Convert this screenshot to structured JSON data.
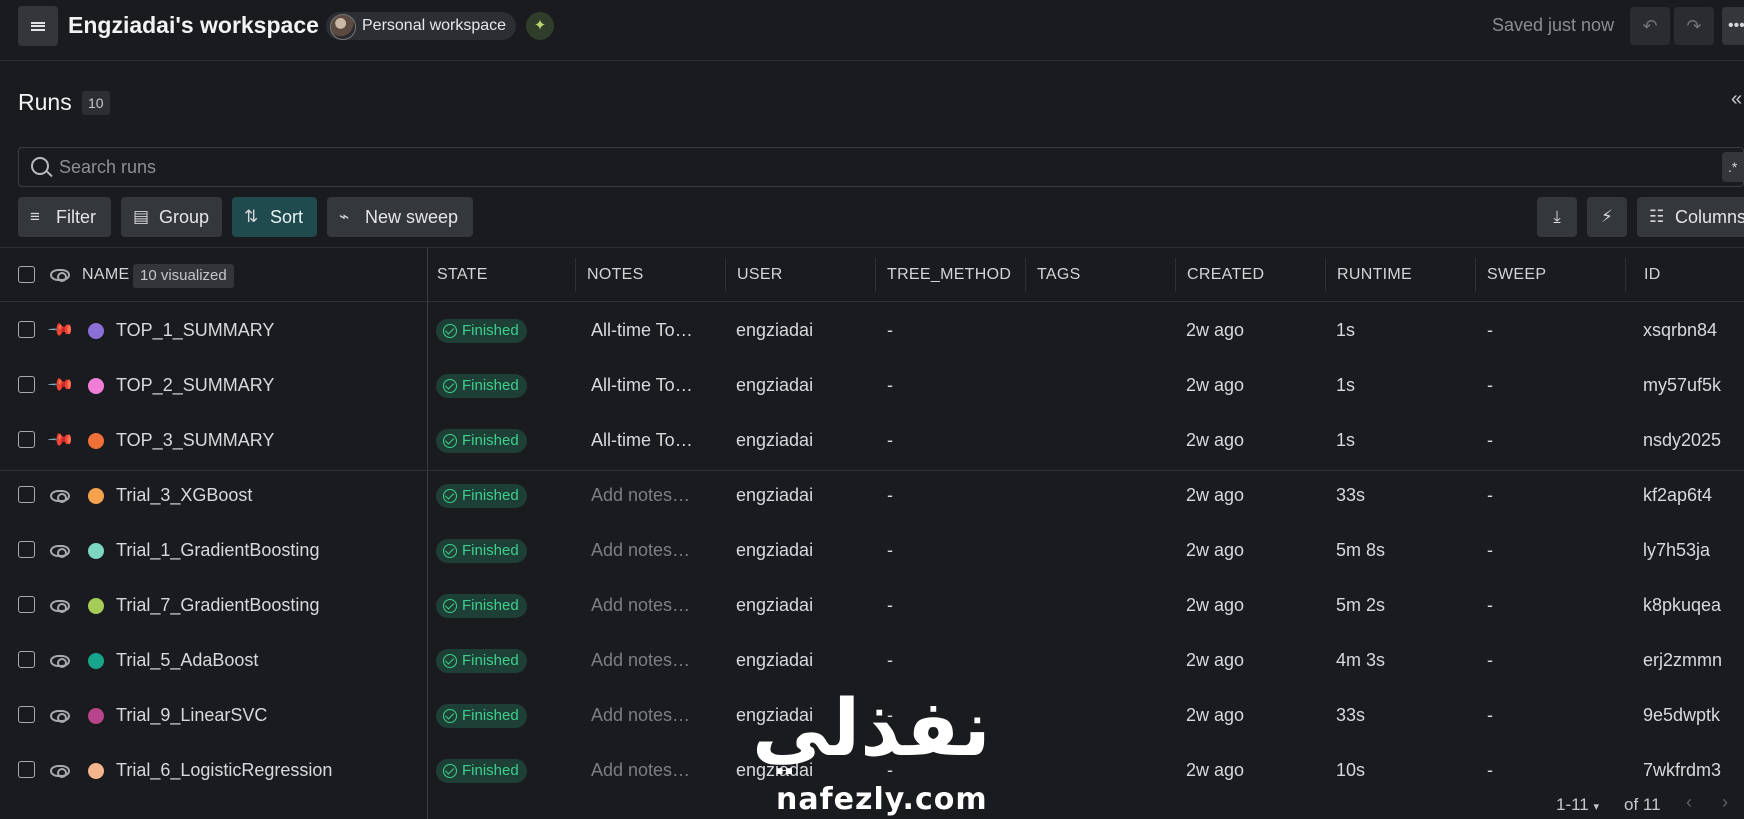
{
  "header": {
    "workspace_title": "Engziadai's workspace",
    "workspace_pill": "Personal workspace",
    "saved_status": "Saved just now"
  },
  "runs": {
    "title": "Runs",
    "count": "10",
    "search_placeholder": "Search runs",
    "regex_label": ".*"
  },
  "toolbar": {
    "filter": "Filter",
    "group": "Group",
    "sort": "Sort",
    "new_sweep": "New sweep",
    "columns": "Columns"
  },
  "table": {
    "name_header": "NAME",
    "visualized_badge": "10 visualized",
    "columns": [
      "STATE",
      "NOTES",
      "USER",
      "TREE_METHOD",
      "TAGS",
      "CREATED",
      "RUNTIME",
      "SWEEP",
      "ID"
    ],
    "rows": [
      {
        "name": "TOP_1_SUMMARY",
        "color": "#8b6fd6",
        "pinned": true,
        "state": "Finished",
        "notes": "All-time To…",
        "notes_placeholder": false,
        "user": "engziadai",
        "tree_method": "-",
        "tags": "",
        "created": "2w ago",
        "runtime": "1s",
        "sweep": "-",
        "id": "xsqrbn84"
      },
      {
        "name": "TOP_2_SUMMARY",
        "color": "#f07ed8",
        "pinned": true,
        "state": "Finished",
        "notes": "All-time To…",
        "notes_placeholder": false,
        "user": "engziadai",
        "tree_method": "-",
        "tags": "",
        "created": "2w ago",
        "runtime": "1s",
        "sweep": "-",
        "id": "my57uf5k"
      },
      {
        "name": "TOP_3_SUMMARY",
        "color": "#f0703a",
        "pinned": true,
        "state": "Finished",
        "notes": "All-time To…",
        "notes_placeholder": false,
        "user": "engziadai",
        "tree_method": "-",
        "tags": "",
        "created": "2w ago",
        "runtime": "1s",
        "sweep": "-",
        "id": "nsdy2025"
      },
      {
        "name": "Trial_3_XGBoost",
        "color": "#f5a14e",
        "pinned": false,
        "state": "Finished",
        "notes": "Add notes…",
        "notes_placeholder": true,
        "user": "engziadai",
        "tree_method": "-",
        "tags": "",
        "created": "2w ago",
        "runtime": "33s",
        "sweep": "-",
        "id": "kf2ap6t4"
      },
      {
        "name": "Trial_1_GradientBoosting",
        "color": "#7dd6c0",
        "pinned": false,
        "state": "Finished",
        "notes": "Add notes…",
        "notes_placeholder": true,
        "user": "engziadai",
        "tree_method": "-",
        "tags": "",
        "created": "2w ago",
        "runtime": "5m 8s",
        "sweep": "-",
        "id": "ly7h53ja"
      },
      {
        "name": "Trial_7_GradientBoosting",
        "color": "#a6cc58",
        "pinned": false,
        "state": "Finished",
        "notes": "Add notes…",
        "notes_placeholder": true,
        "user": "engziadai",
        "tree_method": "-",
        "tags": "",
        "created": "2w ago",
        "runtime": "5m 2s",
        "sweep": "-",
        "id": "k8pkuqea"
      },
      {
        "name": "Trial_5_AdaBoost",
        "color": "#18a58b",
        "pinned": false,
        "state": "Finished",
        "notes": "Add notes…",
        "notes_placeholder": true,
        "user": "engziadai",
        "tree_method": "-",
        "tags": "",
        "created": "2w ago",
        "runtime": "4m 3s",
        "sweep": "-",
        "id": "erj2zmmn"
      },
      {
        "name": "Trial_9_LinearSVC",
        "color": "#b8448e",
        "pinned": false,
        "state": "Finished",
        "notes": "Add notes…",
        "notes_placeholder": true,
        "user": "engziadai",
        "tree_method": "-",
        "tags": "",
        "created": "2w ago",
        "runtime": "33s",
        "sweep": "-",
        "id": "9e5dwptk"
      },
      {
        "name": "Trial_6_LogisticRegression",
        "color": "#f3b48e",
        "pinned": false,
        "state": "Finished",
        "notes": "Add notes…",
        "notes_placeholder": true,
        "user": "engziadai",
        "tree_method": "-",
        "tags": "",
        "created": "2w ago",
        "runtime": "10s",
        "sweep": "-",
        "id": "7wkfrdm3"
      }
    ]
  },
  "pager": {
    "range": "1-11",
    "of_total": "of 11"
  },
  "watermark": {
    "arabic": "نفذلي",
    "latin": "nafezly.com"
  }
}
